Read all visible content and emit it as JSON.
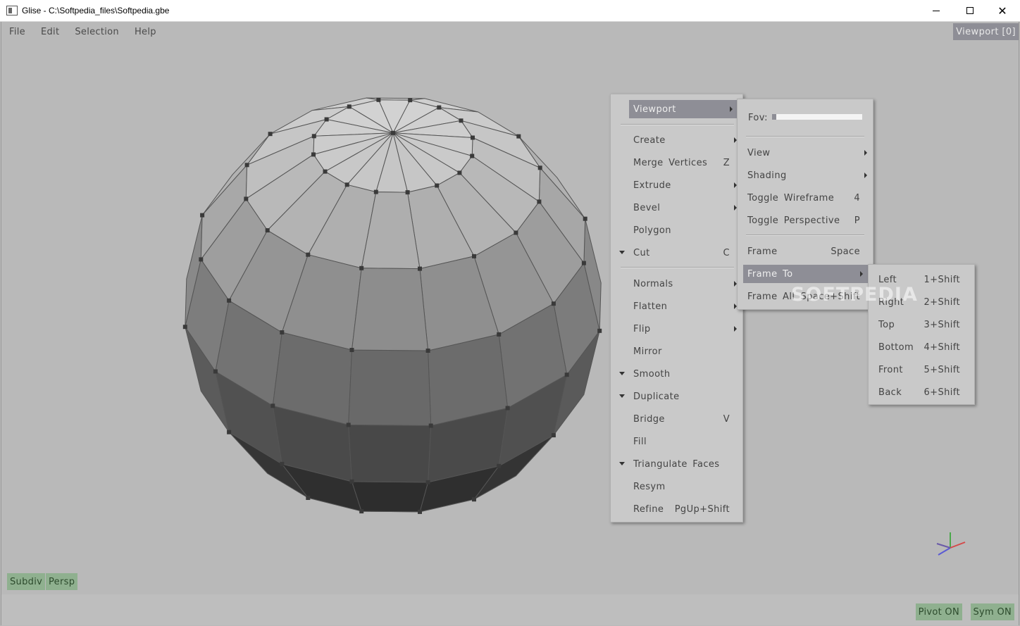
{
  "window": {
    "title": "Glise - C:\\Softpedia_files\\Softpedia.gbe",
    "minimize_glyph": "",
    "maximize_glyph": "",
    "close_glyph": "✕"
  },
  "menubar": [
    "File",
    "Edit",
    "Selection",
    "Help"
  ],
  "viewport_label": "Viewport  [0]",
  "main_menu": {
    "items": [
      {
        "label": "Viewport",
        "arrow": true,
        "active": true
      },
      {
        "label": "Create",
        "arrow": true
      },
      {
        "label": "Merge  Vertices",
        "shortcut": "Z"
      },
      {
        "label": "Extrude",
        "arrow": true
      },
      {
        "label": "Bevel",
        "arrow": true
      },
      {
        "label": "Polygon"
      },
      {
        "label": "Cut",
        "shortcut": "C",
        "checked": true
      },
      {
        "label": "Normals",
        "arrow": true
      },
      {
        "label": "Flatten",
        "arrow": true
      },
      {
        "label": "Flip",
        "arrow": true
      },
      {
        "label": "Mirror"
      },
      {
        "label": "Smooth",
        "checked": true
      },
      {
        "label": "Duplicate",
        "checked": true
      },
      {
        "label": "Bridge",
        "shortcut": "V"
      },
      {
        "label": "Fill"
      },
      {
        "label": "Triangulate  Faces",
        "checked": true
      },
      {
        "label": "Resym"
      },
      {
        "label": "Refine",
        "shortcut": "PgUp+Shift"
      }
    ]
  },
  "viewport_menu": {
    "fov_label": "Fov:",
    "fov_level": 0.05,
    "items": [
      {
        "label": "View",
        "arrow": true
      },
      {
        "label": "Shading",
        "arrow": true
      },
      {
        "label": "Toggle  Wireframe",
        "shortcut": "4"
      },
      {
        "label": "Toggle  Perspective",
        "shortcut": "P"
      },
      {
        "label": "Frame",
        "shortcut": "Space"
      },
      {
        "label": "Frame  To",
        "arrow": true,
        "active": true
      },
      {
        "label": "Frame  All",
        "shortcut": "Space+Shift"
      }
    ]
  },
  "frame_to_menu": {
    "items": [
      {
        "label": "Left",
        "shortcut": "1+Shift"
      },
      {
        "label": "Right",
        "shortcut": "2+Shift"
      },
      {
        "label": "Top",
        "shortcut": "3+Shift"
      },
      {
        "label": "Bottom",
        "shortcut": "4+Shift"
      },
      {
        "label": "Front",
        "shortcut": "5+Shift"
      },
      {
        "label": "Back",
        "shortcut": "6+Shift"
      }
    ]
  },
  "status": {
    "subdiv": "Subdiv",
    "persp": "Persp",
    "pivot": "Pivot  ON",
    "sym": "Sym  ON"
  },
  "watermark": "SOFTPEDIA",
  "colors": {
    "viewport_bg": "#b9b9b9",
    "menu_bg": "#c9c9c9",
    "menu_active": "#8e8e96",
    "chip_green": "#8fb08f",
    "axis_x": "#d44a4a",
    "axis_y": "#4aa84a",
    "axis_z": "#5a5ad4"
  }
}
